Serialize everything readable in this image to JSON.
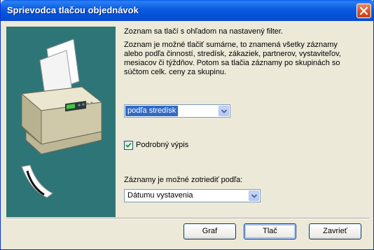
{
  "window": {
    "title": "Sprievodca tlačou objednávok"
  },
  "content": {
    "intro_text": "Zoznam sa tlačí s ohľadom na nastavený filter.",
    "description_lines": [
      "Zoznam je možné tlačiť sumárne, to znamená všetky záznamy",
      "alebo podľa činností, stredísk, zákaziek, partnerov, vystaviteľov,",
      "mesiacov či týždňov. Potom sa tlačia záznamy po skupinách so",
      "súčtom celk. ceny za skupinu."
    ],
    "group_select_value": "podľa stredísk",
    "detail_checkbox_label": "Podrobný výpis",
    "detail_checkbox_checked": true,
    "sort_label": "Záznamy je možné zotriediť podľa:",
    "sort_select_value": "Dátumu vystavenia"
  },
  "buttons": {
    "graph": "Graf",
    "print": "Tlač",
    "close": "Zavrieť"
  },
  "colors": {
    "title_bar": "#0A5FE8",
    "image_bg": "#2E7577",
    "selection": "#316AC5",
    "dialog_bg": "#ECE9D8"
  }
}
